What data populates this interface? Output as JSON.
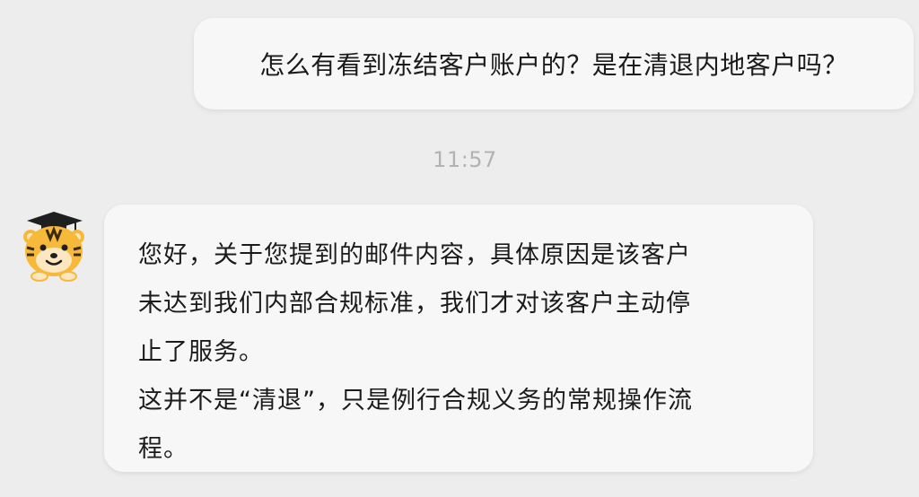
{
  "conversation": {
    "outgoing_message": "怎么有看到冻结客户账户的？是在清退内地客户吗？",
    "timestamp": "11:57",
    "assistant_avatar": "tiger-graduate-avatar-icon",
    "incoming_message_lines": [
      "您好，关于您提到的邮件内容，具体原因是该客户",
      "未达到我们内部合规标准，我们才对该客户主动停",
      "止了服务。",
      "这并不是“清退”，只是例行合规义务的常规操作流",
      "程。"
    ]
  },
  "colors": {
    "background": "#ededed",
    "bubble": "#f7f7f8",
    "text": "#1b1b1b",
    "timestamp": "#b2b2b2",
    "tiger_orange": "#f7b93a"
  }
}
